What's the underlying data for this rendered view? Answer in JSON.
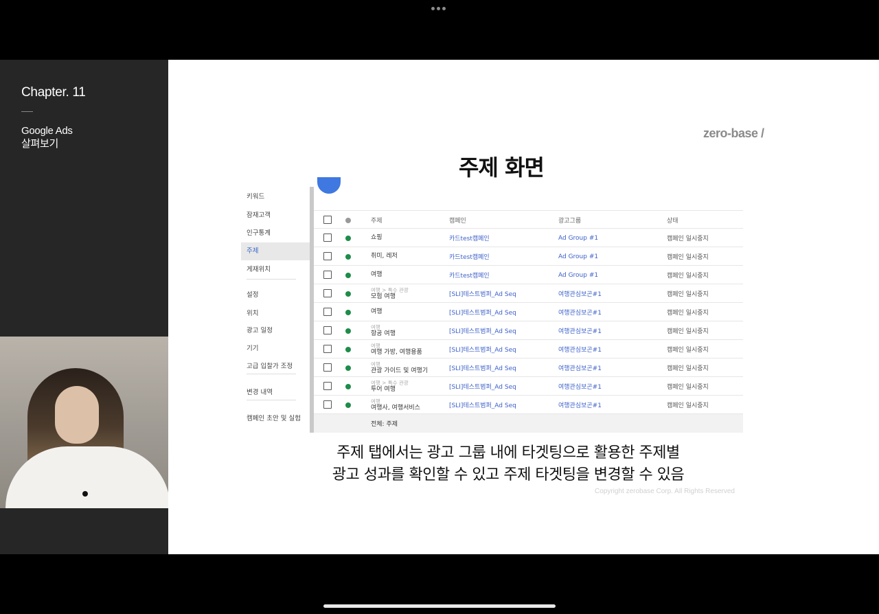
{
  "sidebar": {
    "chapter": "Chapter. 11",
    "course_title_line1": "Google Ads",
    "course_title_line2": "살펴보기"
  },
  "slide": {
    "brand": "zero-base /",
    "title": "주제 화면",
    "nav": [
      {
        "label": "키워드"
      },
      {
        "label": "잠재고객"
      },
      {
        "label": "인구통계"
      },
      {
        "label": "주제",
        "active": true
      },
      {
        "label": "게재위치"
      },
      {
        "label": "설정"
      },
      {
        "label": "위치"
      },
      {
        "label": "광고 일정"
      },
      {
        "label": "기기"
      },
      {
        "label": "고급 입찰가 조정"
      },
      {
        "label": "변경 내역"
      },
      {
        "label": "캠페인 초안 및 실험"
      }
    ],
    "table": {
      "headers": {
        "topic": "주제",
        "campaign": "캠페인",
        "ad_group": "광고그룹",
        "status": "상태"
      },
      "rows": [
        {
          "path": "",
          "topic": "쇼핑",
          "campaign": "카드test캠페인",
          "ad_group": "Ad Group #1",
          "status": "캠페인 일시중지"
        },
        {
          "path": "",
          "topic": "취미, 레저",
          "campaign": "카드test캠페인",
          "ad_group": "Ad Group #1",
          "status": "캠페인 일시중지"
        },
        {
          "path": "",
          "topic": "여행",
          "campaign": "카드test캠페인",
          "ad_group": "Ad Group #1",
          "status": "캠페인 일시중지"
        },
        {
          "path": "여행 > 특수 관광",
          "topic": "모험 여행",
          "campaign": "[SLI]테스트범퍼_Ad Seq",
          "ad_group": "여행관심보곤#1",
          "status": "캠페인 일시중지"
        },
        {
          "path": "",
          "topic": "여행",
          "campaign": "[SLI]테스트범퍼_Ad Seq",
          "ad_group": "여행관심보곤#1",
          "status": "캠페인 일시중지"
        },
        {
          "path": "여행",
          "topic": "항공 여행",
          "campaign": "[SLI]테스트범퍼_Ad Seq",
          "ad_group": "여행관심보곤#1",
          "status": "캠페인 일시중지"
        },
        {
          "path": "여행",
          "topic": "여행 가방, 여행용품",
          "campaign": "[SLI]테스트범퍼_Ad Seq",
          "ad_group": "여행관심보곤#1",
          "status": "캠페인 일시중지"
        },
        {
          "path": "여행",
          "topic": "관광 가이드 및 여행기",
          "campaign": "[SLI]테스트범퍼_Ad Seq",
          "ad_group": "여행관심보곤#1",
          "status": "캠페인 일시중지"
        },
        {
          "path": "여행 > 특수 관광",
          "topic": "투어 여행",
          "campaign": "[SLI]테스트범퍼_Ad Seq",
          "ad_group": "여행관심보곤#1",
          "status": "캠페인 일시중지"
        },
        {
          "path": "여행",
          "topic": "여행사, 여행서비스",
          "campaign": "[SLI]테스트범퍼_Ad Seq",
          "ad_group": "여행관심보곤#1",
          "status": "캠페인 일시중지"
        }
      ],
      "footer": "전체: 주제"
    },
    "subtitle_line1": "주제 탭에서는 광고 그룹 내에 타겟팅으로 활용한 주제별",
    "subtitle_line2": "광고 성과를 확인할 수 있고 주제 타겟팅을 변경할 수 있음",
    "copyright": "Copyright zerobase Corp. All Rights Reserved"
  },
  "colors": {
    "active_dot": "#1e8c4a",
    "link": "#3b5fc9",
    "sidebar_bg": "#262626"
  }
}
